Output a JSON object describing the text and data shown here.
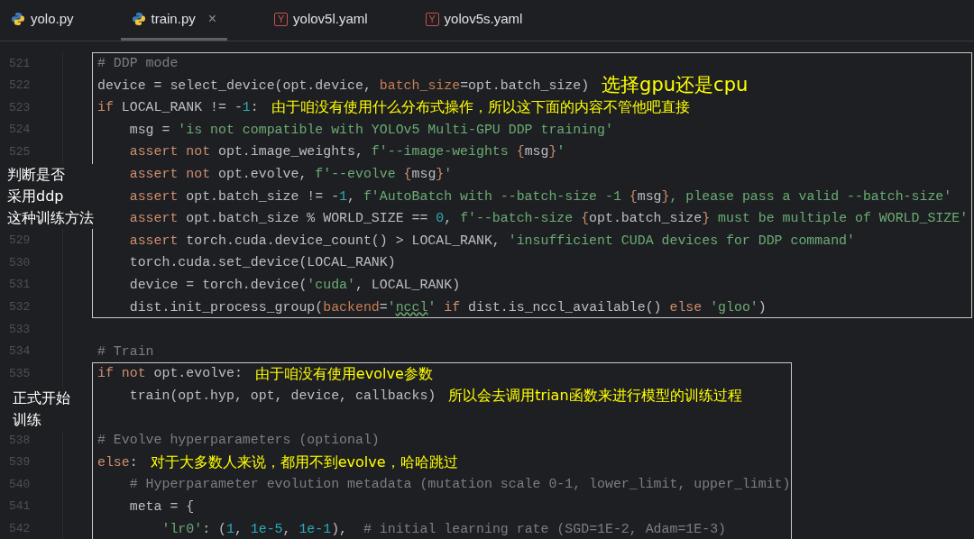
{
  "tabs": [
    {
      "kind": "python",
      "label": "yolo.py",
      "selected": false
    },
    {
      "kind": "python",
      "label": "train.py",
      "selected": true,
      "close": "×"
    },
    {
      "kind": "yaml",
      "icon_letter": "Y",
      "label": "yolov5l.yaml",
      "selected": false
    },
    {
      "kind": "yaml",
      "icon_letter": "Y",
      "label": "yolov5s.yaml",
      "selected": false
    }
  ],
  "code_blocks": [
    {
      "boxed": true,
      "lines": [
        {
          "number": "521",
          "tokens": [
            {
              "kind": "comment",
              "text": "# DDP mode"
            }
          ]
        },
        {
          "number": "522",
          "tokens": [
            {
              "kind": "plain",
              "text": "device = select_device(opt.device, "
            },
            {
              "kind": "param",
              "text": "batch_size"
            },
            {
              "kind": "plain",
              "text": "=opt.batch_size)"
            }
          ],
          "note": {
            "kind": "large",
            "text": "选择gpu还是cpu"
          }
        },
        {
          "number": "523",
          "tokens": [
            {
              "kind": "keyword",
              "text": "if"
            },
            {
              "kind": "plain",
              "text": " LOCAL_RANK != -"
            },
            {
              "kind": "number",
              "text": "1"
            },
            {
              "kind": "plain",
              "text": ":"
            }
          ],
          "note": {
            "kind": "normal",
            "text": "由于咱没有使用什么分布式操作，所以这下面的内容不管他吧直接"
          }
        },
        {
          "number": "524",
          "tokens": [
            {
              "kind": "plain",
              "text": "    msg = "
            },
            {
              "kind": "string",
              "text": "'is not compatible with YOLOv5 Multi-GPU DDP training'"
            }
          ]
        },
        {
          "number": "525",
          "tokens": [
            {
              "kind": "keyword",
              "text": "    assert not"
            },
            {
              "kind": "plain",
              "text": " opt.image_weights, "
            },
            {
              "kind": "string",
              "text": "f'--image-weights "
            },
            {
              "kind": "brace",
              "text": "{"
            },
            {
              "kind": "plain",
              "text": "msg"
            },
            {
              "kind": "brace",
              "text": "}"
            },
            {
              "kind": "string",
              "text": "'"
            }
          ]
        },
        {
          "tokens": [
            {
              "kind": "keyword",
              "text": "    assert not"
            },
            {
              "kind": "plain",
              "text": " opt.evolve, "
            },
            {
              "kind": "string",
              "text": "f'--evolve "
            },
            {
              "kind": "brace",
              "text": "{"
            },
            {
              "kind": "plain",
              "text": "msg"
            },
            {
              "kind": "brace",
              "text": "}"
            },
            {
              "kind": "string",
              "text": "'"
            }
          ]
        },
        {
          "tokens": [
            {
              "kind": "keyword",
              "text": "    assert"
            },
            {
              "kind": "plain",
              "text": " opt.batch_size != -"
            },
            {
              "kind": "number",
              "text": "1"
            },
            {
              "kind": "plain",
              "text": ", "
            },
            {
              "kind": "string",
              "text": "f'AutoBatch with --batch-size -1 "
            },
            {
              "kind": "brace",
              "text": "{"
            },
            {
              "kind": "plain",
              "text": "msg"
            },
            {
              "kind": "brace",
              "text": "}"
            },
            {
              "kind": "string",
              "text": ", please pass a valid --batch-size'"
            }
          ]
        },
        {
          "tokens": [
            {
              "kind": "keyword",
              "text": "    assert"
            },
            {
              "kind": "plain",
              "text": " opt.batch_size % WORLD_SIZE == "
            },
            {
              "kind": "number",
              "text": "0"
            },
            {
              "kind": "plain",
              "text": ", "
            },
            {
              "kind": "string",
              "text": "f'--batch-size "
            },
            {
              "kind": "brace",
              "text": "{"
            },
            {
              "kind": "plain",
              "text": "opt.batch_size"
            },
            {
              "kind": "brace",
              "text": "}"
            },
            {
              "kind": "string",
              "text": " must be multiple of WORLD_SIZE'"
            }
          ]
        },
        {
          "number": "529",
          "tokens": [
            {
              "kind": "keyword",
              "text": "    assert"
            },
            {
              "kind": "plain",
              "text": " torch.cuda.device_count() > LOCAL_RANK, "
            },
            {
              "kind": "string",
              "text": "'insufficient CUDA devices for DDP command'"
            }
          ]
        },
        {
          "number": "530",
          "tokens": [
            {
              "kind": "plain",
              "text": "    torch.cuda.set_device(LOCAL_RANK)"
            }
          ]
        },
        {
          "number": "531",
          "tokens": [
            {
              "kind": "plain",
              "text": "    device = torch.device("
            },
            {
              "kind": "string",
              "text": "'cuda'"
            },
            {
              "kind": "plain",
              "text": ", LOCAL_RANK)"
            }
          ]
        },
        {
          "number": "532",
          "tokens": [
            {
              "kind": "plain",
              "text": "    dist.init_process_group("
            },
            {
              "kind": "param",
              "text": "backend"
            },
            {
              "kind": "plain",
              "text": "="
            },
            {
              "kind": "string",
              "text": "'"
            },
            {
              "kind": "typo_string",
              "text": "nccl"
            },
            {
              "kind": "string",
              "text": "'"
            },
            {
              "kind": "keyword",
              "text": " if"
            },
            {
              "kind": "plain",
              "text": " dist.is_nccl_available() "
            },
            {
              "kind": "keyword",
              "text": "else "
            },
            {
              "kind": "string",
              "text": "'gloo'"
            },
            {
              "kind": "plain",
              "text": ")"
            }
          ]
        }
      ]
    },
    {
      "boxed": false,
      "lines": [
        {
          "number": "533"
        },
        {
          "number": "534",
          "tokens": [
            {
              "kind": "comment",
              "text": "# Train"
            }
          ]
        }
      ]
    },
    {
      "boxed": true,
      "lines": [
        {
          "number": "535",
          "tokens": [
            {
              "kind": "keyword",
              "text": "if not"
            },
            {
              "kind": "plain",
              "text": " opt.evolve:"
            }
          ],
          "note": {
            "kind": "normal",
            "text": "由于咱没有使用evolve参数"
          }
        },
        {
          "tokens": [
            {
              "kind": "plain",
              "text": "    train(opt.hyp, opt, device, callbacks)"
            }
          ],
          "note": {
            "kind": "normal",
            "text": "所以会去调用trian函数来进行模型的训练过程"
          }
        }
      ],
      "lines_after_blank": [
        {
          "number": "538",
          "tokens": [
            {
              "kind": "comment",
              "text": "# Evolve hyperparameters (optional)"
            }
          ]
        },
        {
          "number": "539",
          "tokens": [
            {
              "kind": "keyword",
              "text": "else"
            },
            {
              "kind": "plain",
              "text": ":"
            }
          ],
          "note": {
            "kind": "normal",
            "text": "对于大多数人来说，都用不到evolve，哈哈跳过"
          }
        },
        {
          "number": "540",
          "tokens": [
            {
              "kind": "comment",
              "text": "    # Hyperparameter evolution metadata (mutation scale 0-1, lower_limit, upper_limit)"
            }
          ]
        },
        {
          "number": "541",
          "tokens": [
            {
              "kind": "plain",
              "text": "    meta = {"
            }
          ]
        },
        {
          "number": "542",
          "tokens": [
            {
              "kind": "string",
              "text": "        'lr0'"
            },
            {
              "kind": "plain",
              "text": ": ("
            },
            {
              "kind": "number",
              "text": "1"
            },
            {
              "kind": "plain",
              "text": ", "
            },
            {
              "kind": "number",
              "text": "1e-5"
            },
            {
              "kind": "plain",
              "text": ", "
            },
            {
              "kind": "number",
              "text": "1e-1"
            },
            {
              "kind": "plain",
              "text": "),  "
            },
            {
              "kind": "comment",
              "text": "# initial learning rate (SGD=1E-2, Adam=1E-3)"
            }
          ]
        }
      ]
    }
  ],
  "side_notes": [
    {
      "lines": [
        "判断是否",
        "采用ddp",
        "这种训练方法"
      ]
    },
    {
      "lines": [
        "正式开始",
        "训练"
      ]
    }
  ]
}
